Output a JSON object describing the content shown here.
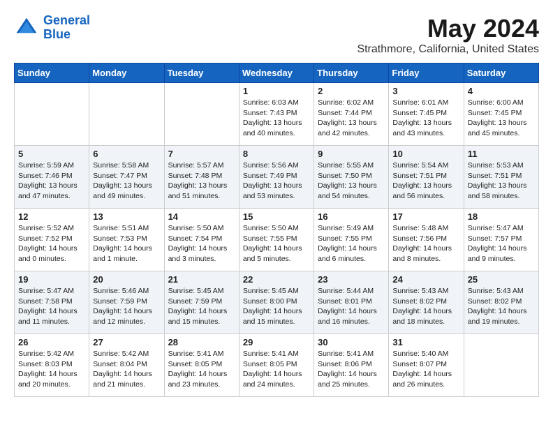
{
  "header": {
    "logo_line1": "General",
    "logo_line2": "Blue",
    "month": "May 2024",
    "location": "Strathmore, California, United States"
  },
  "days_of_week": [
    "Sunday",
    "Monday",
    "Tuesday",
    "Wednesday",
    "Thursday",
    "Friday",
    "Saturday"
  ],
  "weeks": [
    [
      {
        "day": "",
        "info": ""
      },
      {
        "day": "",
        "info": ""
      },
      {
        "day": "",
        "info": ""
      },
      {
        "day": "1",
        "info": "Sunrise: 6:03 AM\nSunset: 7:43 PM\nDaylight: 13 hours and 40 minutes."
      },
      {
        "day": "2",
        "info": "Sunrise: 6:02 AM\nSunset: 7:44 PM\nDaylight: 13 hours and 42 minutes."
      },
      {
        "day": "3",
        "info": "Sunrise: 6:01 AM\nSunset: 7:45 PM\nDaylight: 13 hours and 43 minutes."
      },
      {
        "day": "4",
        "info": "Sunrise: 6:00 AM\nSunset: 7:45 PM\nDaylight: 13 hours and 45 minutes."
      }
    ],
    [
      {
        "day": "5",
        "info": "Sunrise: 5:59 AM\nSunset: 7:46 PM\nDaylight: 13 hours and 47 minutes."
      },
      {
        "day": "6",
        "info": "Sunrise: 5:58 AM\nSunset: 7:47 PM\nDaylight: 13 hours and 49 minutes."
      },
      {
        "day": "7",
        "info": "Sunrise: 5:57 AM\nSunset: 7:48 PM\nDaylight: 13 hours and 51 minutes."
      },
      {
        "day": "8",
        "info": "Sunrise: 5:56 AM\nSunset: 7:49 PM\nDaylight: 13 hours and 53 minutes."
      },
      {
        "day": "9",
        "info": "Sunrise: 5:55 AM\nSunset: 7:50 PM\nDaylight: 13 hours and 54 minutes."
      },
      {
        "day": "10",
        "info": "Sunrise: 5:54 AM\nSunset: 7:51 PM\nDaylight: 13 hours and 56 minutes."
      },
      {
        "day": "11",
        "info": "Sunrise: 5:53 AM\nSunset: 7:51 PM\nDaylight: 13 hours and 58 minutes."
      }
    ],
    [
      {
        "day": "12",
        "info": "Sunrise: 5:52 AM\nSunset: 7:52 PM\nDaylight: 14 hours and 0 minutes."
      },
      {
        "day": "13",
        "info": "Sunrise: 5:51 AM\nSunset: 7:53 PM\nDaylight: 14 hours and 1 minute."
      },
      {
        "day": "14",
        "info": "Sunrise: 5:50 AM\nSunset: 7:54 PM\nDaylight: 14 hours and 3 minutes."
      },
      {
        "day": "15",
        "info": "Sunrise: 5:50 AM\nSunset: 7:55 PM\nDaylight: 14 hours and 5 minutes."
      },
      {
        "day": "16",
        "info": "Sunrise: 5:49 AM\nSunset: 7:55 PM\nDaylight: 14 hours and 6 minutes."
      },
      {
        "day": "17",
        "info": "Sunrise: 5:48 AM\nSunset: 7:56 PM\nDaylight: 14 hours and 8 minutes."
      },
      {
        "day": "18",
        "info": "Sunrise: 5:47 AM\nSunset: 7:57 PM\nDaylight: 14 hours and 9 minutes."
      }
    ],
    [
      {
        "day": "19",
        "info": "Sunrise: 5:47 AM\nSunset: 7:58 PM\nDaylight: 14 hours and 11 minutes."
      },
      {
        "day": "20",
        "info": "Sunrise: 5:46 AM\nSunset: 7:59 PM\nDaylight: 14 hours and 12 minutes."
      },
      {
        "day": "21",
        "info": "Sunrise: 5:45 AM\nSunset: 7:59 PM\nDaylight: 14 hours and 15 minutes."
      },
      {
        "day": "22",
        "info": "Sunrise: 5:45 AM\nSunset: 8:00 PM\nDaylight: 14 hours and 15 minutes."
      },
      {
        "day": "23",
        "info": "Sunrise: 5:44 AM\nSunset: 8:01 PM\nDaylight: 14 hours and 16 minutes."
      },
      {
        "day": "24",
        "info": "Sunrise: 5:43 AM\nSunset: 8:02 PM\nDaylight: 14 hours and 18 minutes."
      },
      {
        "day": "25",
        "info": "Sunrise: 5:43 AM\nSunset: 8:02 PM\nDaylight: 14 hours and 19 minutes."
      }
    ],
    [
      {
        "day": "26",
        "info": "Sunrise: 5:42 AM\nSunset: 8:03 PM\nDaylight: 14 hours and 20 minutes."
      },
      {
        "day": "27",
        "info": "Sunrise: 5:42 AM\nSunset: 8:04 PM\nDaylight: 14 hours and 21 minutes."
      },
      {
        "day": "28",
        "info": "Sunrise: 5:41 AM\nSunset: 8:05 PM\nDaylight: 14 hours and 23 minutes."
      },
      {
        "day": "29",
        "info": "Sunrise: 5:41 AM\nSunset: 8:05 PM\nDaylight: 14 hours and 24 minutes."
      },
      {
        "day": "30",
        "info": "Sunrise: 5:41 AM\nSunset: 8:06 PM\nDaylight: 14 hours and 25 minutes."
      },
      {
        "day": "31",
        "info": "Sunrise: 5:40 AM\nSunset: 8:07 PM\nDaylight: 14 hours and 26 minutes."
      },
      {
        "day": "",
        "info": ""
      }
    ]
  ]
}
